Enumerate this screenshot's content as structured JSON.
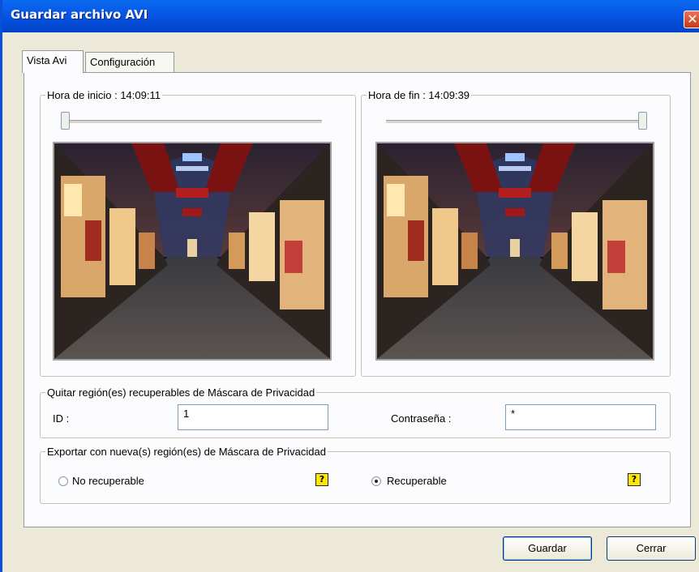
{
  "window": {
    "title": "Guardar archivo AVI",
    "close_glyph": "✕"
  },
  "tabs": [
    {
      "label": "Vista Avi",
      "active": true
    },
    {
      "label": "Configuración",
      "active": false
    }
  ],
  "start": {
    "label": "Hora de inicio : 14:09:11",
    "slider_position": 0
  },
  "end": {
    "label": "Hora de fin : 14:09:39",
    "slider_position": 1
  },
  "remove_group": {
    "legend": "Quitar región(es) recuperables de Máscara de Privacidad",
    "id_label": "ID :",
    "id_value": "1",
    "password_label": "Contraseña :",
    "password_value": "*"
  },
  "export_group": {
    "legend": "Exportar con nueva(s) región(es) de Máscara de Privacidad",
    "options": [
      {
        "label": "No recuperable",
        "checked": false
      },
      {
        "label": "Recuperable",
        "checked": true
      }
    ],
    "help_glyph": "?"
  },
  "buttons": {
    "save": "Guardar",
    "close": "Cerrar"
  },
  "colors": {
    "titlebar": "#0758e6",
    "dialog_bg": "#ece9d8",
    "help_bg": "#ffe600"
  }
}
